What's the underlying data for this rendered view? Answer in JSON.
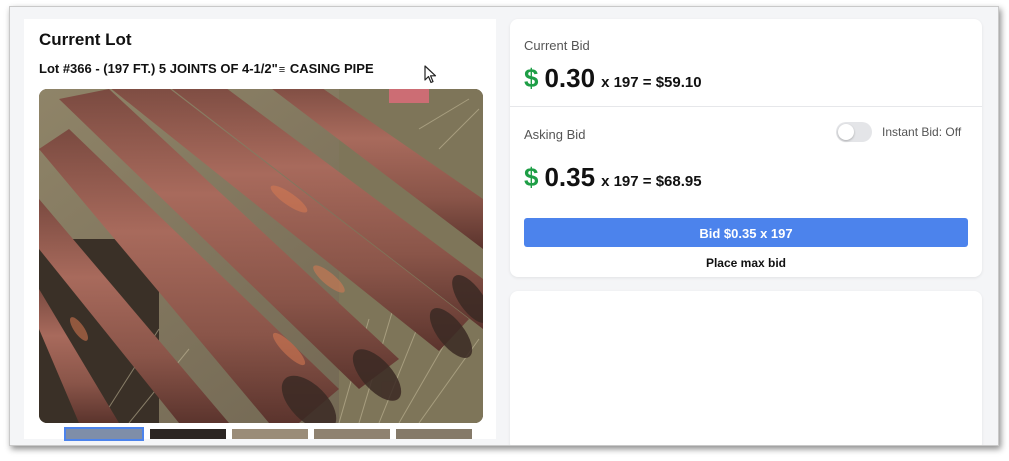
{
  "lot": {
    "heading": "Current Lot",
    "number": "Lot #366",
    "title_rest": " - (197 FT.) 5 JOINTS OF 4-1/2\"",
    "title_glyph": "≡",
    "title_end": " CASING PIPE",
    "photo_icon": "casing-pipe-photo",
    "thumbnail_count": 5
  },
  "bidding": {
    "current_label": "Current Bid",
    "current_currency": "$",
    "current_amount": "0.30",
    "current_calc": "x 197 = $59.10",
    "asking_label": "Asking Bid",
    "instant_bid_label": "Instant Bid: Off",
    "instant_bid_on": false,
    "asking_currency": "$",
    "asking_amount": "0.35",
    "asking_calc": "x 197 = $68.95",
    "bid_button": "Bid $0.35 x 197",
    "max_bid_link": "Place max bid"
  },
  "colors": {
    "accent_blue": "#4c83ec",
    "dollar_green": "#1e9e46"
  }
}
